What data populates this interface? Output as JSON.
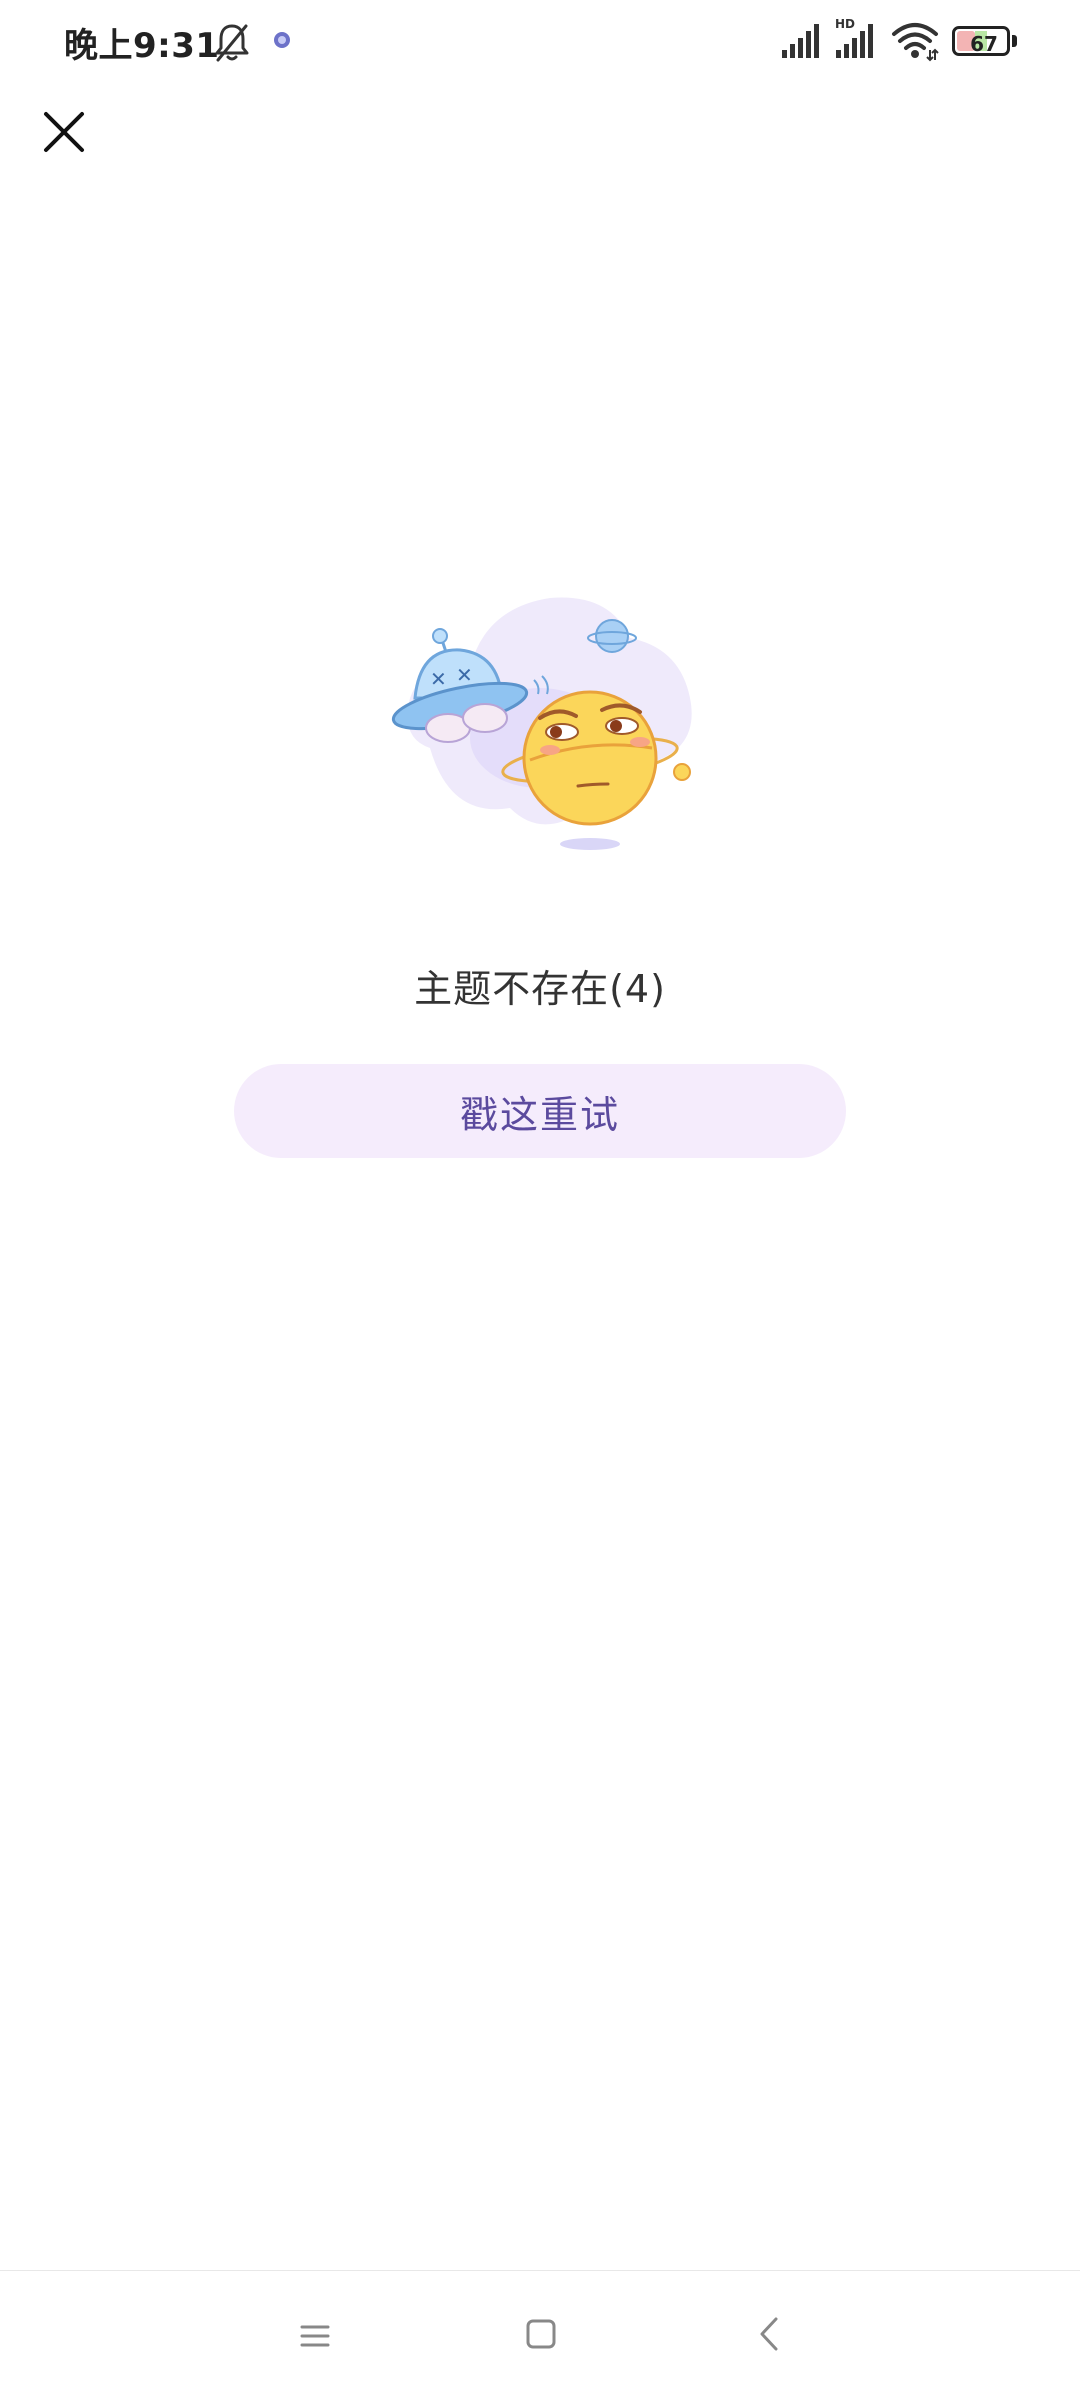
{
  "status_bar": {
    "time": "晚上9:31",
    "battery_level": "67",
    "icons": [
      "bell-off-icon",
      "app-notification-icon",
      "signal-icon",
      "hd-signal-icon",
      "wifi-icon",
      "battery-icon"
    ]
  },
  "header": {
    "close_icon": "close-icon"
  },
  "error": {
    "illustration": "ufo-and-planet-illustration",
    "message": "主题不存在(4)",
    "retry_label": "戳这重试"
  },
  "nav_bar": {
    "icons": [
      "menu-icon",
      "home-icon",
      "back-icon"
    ]
  },
  "colors": {
    "retry_bg": "#f5ecfc",
    "retry_text": "#5b4a9e",
    "message_text": "#333333"
  }
}
